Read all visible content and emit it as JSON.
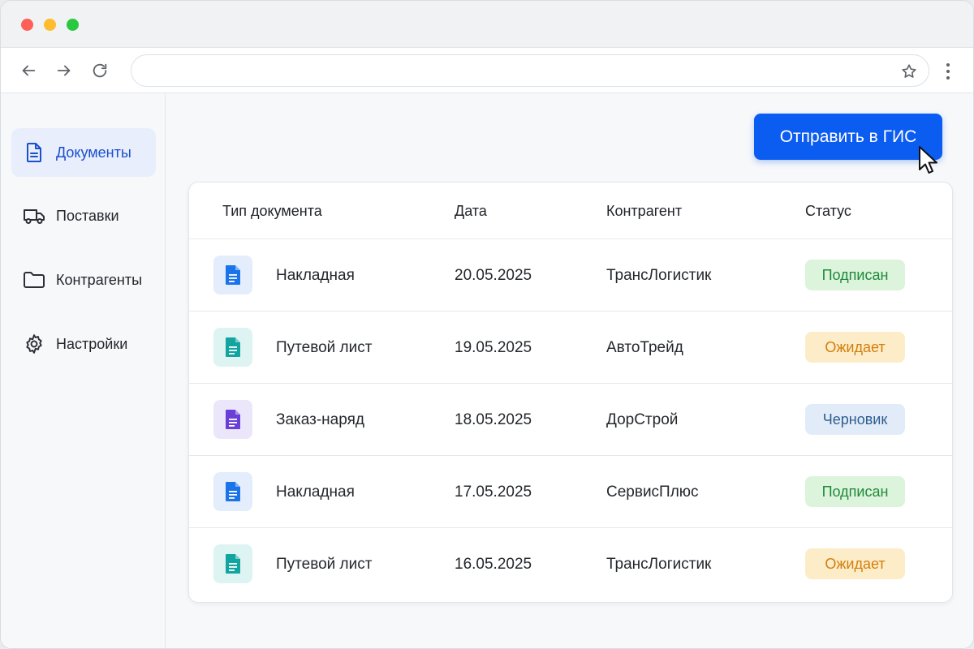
{
  "browser": {
    "address_value": "",
    "colors": {
      "titlebar": "#f1f2f4",
      "traffic_red": "#ff5f57",
      "traffic_yellow": "#febc2e",
      "traffic_green": "#28c840"
    },
    "icons": {
      "back": "arrow-left-icon",
      "forward": "arrow-right-icon",
      "reload": "reload-icon",
      "bookmark": "star-icon",
      "menu": "kebab-menu-icon"
    }
  },
  "sidebar": {
    "items": [
      {
        "label": "Документы",
        "icon": "document-icon",
        "active": true
      },
      {
        "label": "Поставки",
        "icon": "truck-icon",
        "active": false
      },
      {
        "label": "Контрагенты",
        "icon": "folder-icon",
        "active": false
      },
      {
        "label": "Настройки",
        "icon": "gear-icon",
        "active": false
      }
    ]
  },
  "main": {
    "send_button_label": "Отправить в ГИС",
    "colors": {
      "accent": "#0b5cf0"
    },
    "table": {
      "columns": [
        "Тип документа",
        "Дата",
        "Контрагент",
        "Статус"
      ],
      "rows": [
        {
          "type": "Накладная",
          "date": "20.05.2025",
          "party": "ТрансЛогистик",
          "status": "Подписан",
          "icon_color": "#1a73e8",
          "icon_bg": "#e3edfc"
        },
        {
          "type": "Путевой лист",
          "date": "19.05.2025",
          "party": "АвтоТрейд",
          "status": "Ожидает",
          "icon_color": "#12a4a0",
          "icon_bg": "#ddf4f3"
        },
        {
          "type": "Заказ-наряд",
          "date": "18.05.2025",
          "party": "ДорСтрой",
          "status": "Черновик",
          "icon_color": "#6a3fd8",
          "icon_bg": "#ece6fa"
        },
        {
          "type": "Накладная",
          "date": "17.05.2025",
          "party": "СервисПлюс",
          "status": "Подписан",
          "icon_color": "#1a73e8",
          "icon_bg": "#e3edfc"
        },
        {
          "type": "Путевой лист",
          "date": "16.05.2025",
          "party": "ТрансЛогистик",
          "status": "Ожидает",
          "icon_color": "#12a4a0",
          "icon_bg": "#ddf4f3"
        }
      ],
      "status_colors": {
        "Подписан": {
          "bg": "#dcf3dc",
          "fg": "#1f8a3a"
        },
        "Ожидает": {
          "bg": "#fdecc8",
          "fg": "#d27f0c"
        },
        "Черновик": {
          "bg": "#e2ecf8",
          "fg": "#2f5d8f"
        }
      }
    }
  }
}
